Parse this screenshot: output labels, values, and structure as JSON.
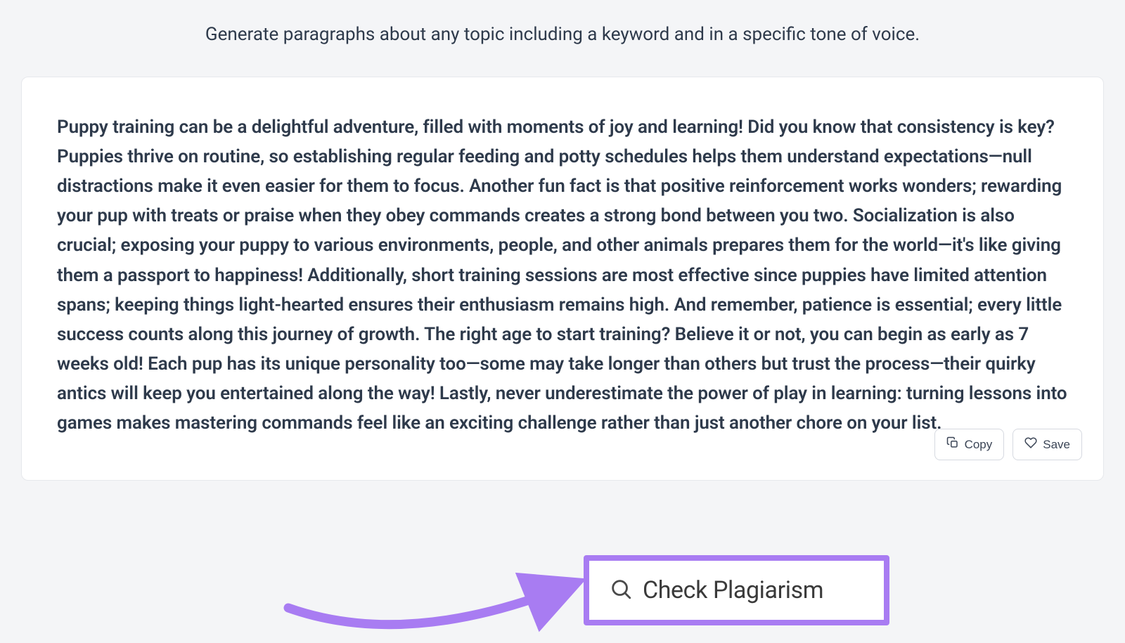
{
  "header": {
    "description": "Generate paragraphs about any topic including a keyword and in a specific tone of voice."
  },
  "generated": {
    "paragraph": "Puppy training can be a delightful adventure, filled with moments of joy and learning! Did you know that consistency is key? Puppies thrive on routine, so establishing regular feeding and potty schedules helps them understand expectations—null distractions make it even easier for them to focus. Another fun fact is that positive reinforcement works wonders; rewarding your pup with treats or praise when they obey commands creates a strong bond between you two. Socialization is also crucial; exposing your puppy to various environments, people, and other animals prepares them for the world—it's like giving them a passport to happiness! Additionally, short training sessions are most effective since puppies have limited attention spans; keeping things light-hearted ensures their enthusiasm remains high. And remember, patience is essential; every little success counts along this journey of growth. The right age to start training? Believe it or not, you can begin as early as 7 weeks old! Each pup has its unique personality too—some may take longer than others but trust the process—their quirky antics will keep you entertained along the way! Lastly, never underestimate the power of play in learning: turning lessons into games makes mastering commands feel like an exciting challenge rather than just another chore on your list."
  },
  "actions": {
    "copy_label": "Copy",
    "save_label": "Save"
  },
  "annotation": {
    "highlight_label": "Check Plagiarism"
  }
}
